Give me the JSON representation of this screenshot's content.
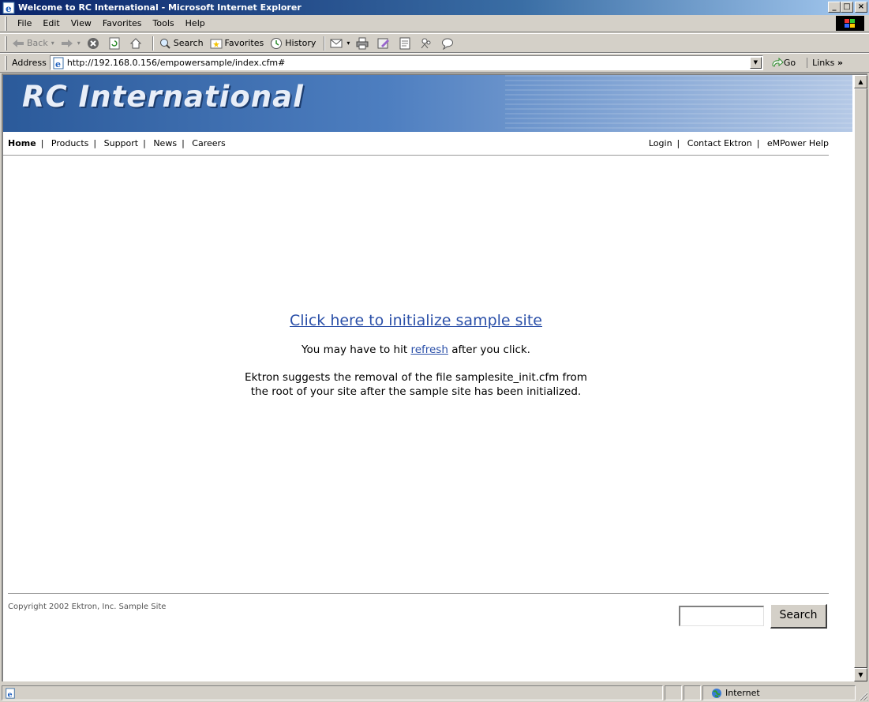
{
  "window": {
    "title": "Welcome to RC International - Microsoft Internet Explorer",
    "minimize": "_",
    "maximize": "□",
    "close": "×"
  },
  "menu": {
    "items": [
      {
        "label": "File"
      },
      {
        "label": "Edit"
      },
      {
        "label": "View"
      },
      {
        "label": "Favorites"
      },
      {
        "label": "Tools"
      },
      {
        "label": "Help"
      }
    ]
  },
  "toolbar": {
    "back": "Back",
    "search": "Search",
    "favorites": "Favorites",
    "history": "History"
  },
  "address": {
    "label": "Address",
    "url": "http://192.168.0.156/empowersample/index.cfm#",
    "go": "Go",
    "links": "Links"
  },
  "site": {
    "logo": "RC International",
    "nav_left": [
      "Home",
      "Products",
      "Support",
      "News",
      "Careers"
    ],
    "nav_right": [
      "Login",
      "Contact Ektron",
      "eMPower Help"
    ],
    "init_link": "Click here to initialize sample site",
    "refresh_prefix": "You may have to hit ",
    "refresh_link": "refresh",
    "refresh_suffix": " after you click.",
    "suggest_line1": "Ektron suggests the removal of the file samplesite_init.cfm from",
    "suggest_line2": "the root of your site after the sample site has been initialized.",
    "copyright": "Copyright 2002 Ektron, Inc. Sample Site",
    "search_value": "",
    "search_button": "Search"
  },
  "status": {
    "zone": "Internet"
  },
  "colors": {
    "title_bar": "#0a246a",
    "link": "#2a4fa8",
    "banner": "#4d7ec0"
  }
}
